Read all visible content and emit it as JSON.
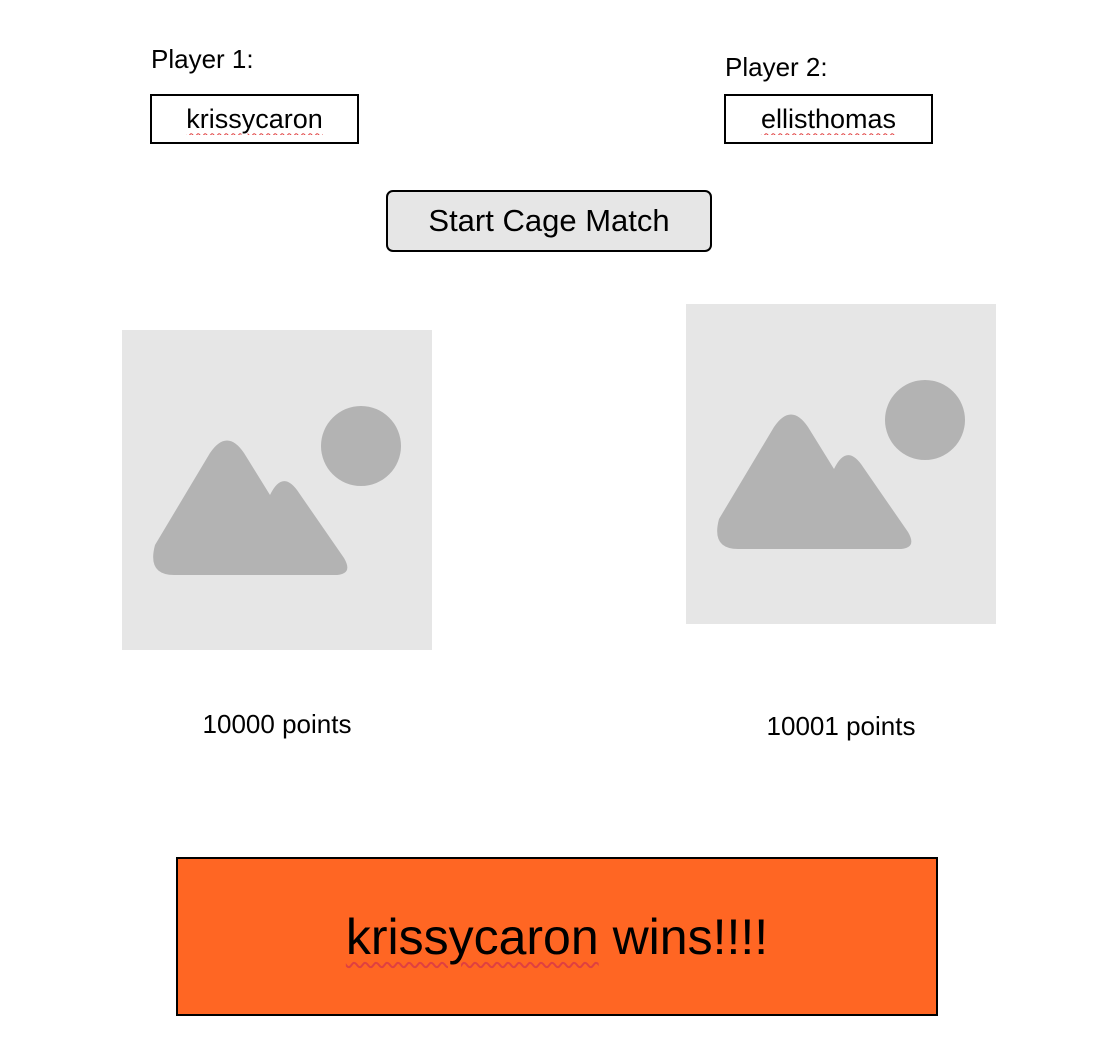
{
  "players": [
    {
      "label": "Player 1:",
      "username": "krissycaron",
      "score_text": "10000 points"
    },
    {
      "label": "Player 2:",
      "username": "ellisthomas",
      "score_text": "10001 points"
    }
  ],
  "start_button": {
    "label": "Start Cage Match"
  },
  "result": {
    "winner": "krissycaron",
    "suffix": " wins!!!!"
  },
  "icons": {
    "avatar_placeholder": "image-placeholder-icon"
  },
  "colors": {
    "banner_background": "#ff6623",
    "button_background": "#e6e6e6",
    "placeholder_background": "#e6e6e6",
    "placeholder_glyph": "#b3b3b3"
  }
}
